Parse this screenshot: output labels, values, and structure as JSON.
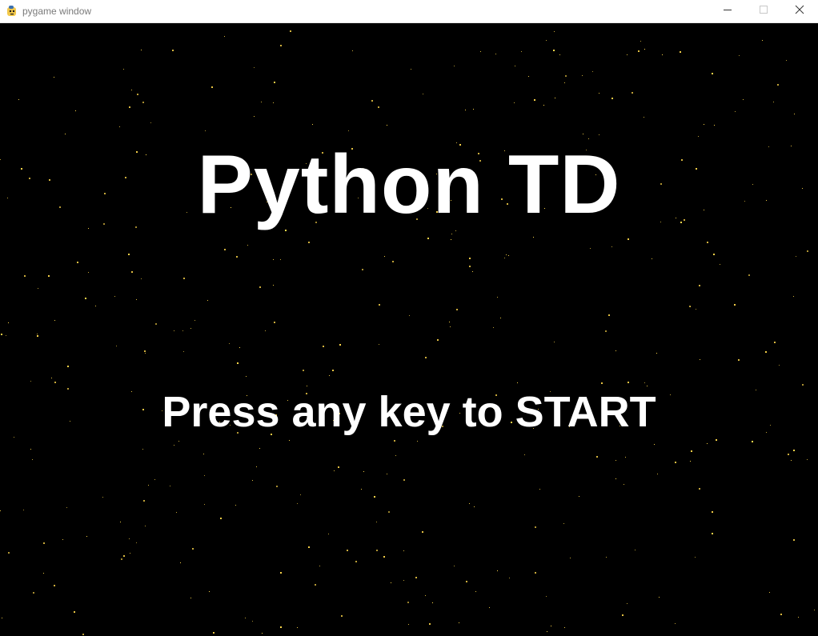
{
  "window": {
    "title": "pygame window",
    "controls": {
      "minimize_icon": "minimize-icon",
      "maximize_icon": "maximize-icon",
      "close_icon": "close-icon"
    },
    "app_icon": "pygame-snake-icon"
  },
  "game": {
    "title": "Python TD",
    "prompt": "Press any key to START"
  },
  "colors": {
    "background": "#000000",
    "text": "#ffffff",
    "star": "#ffd84a",
    "titlebar": "#ffffff"
  }
}
